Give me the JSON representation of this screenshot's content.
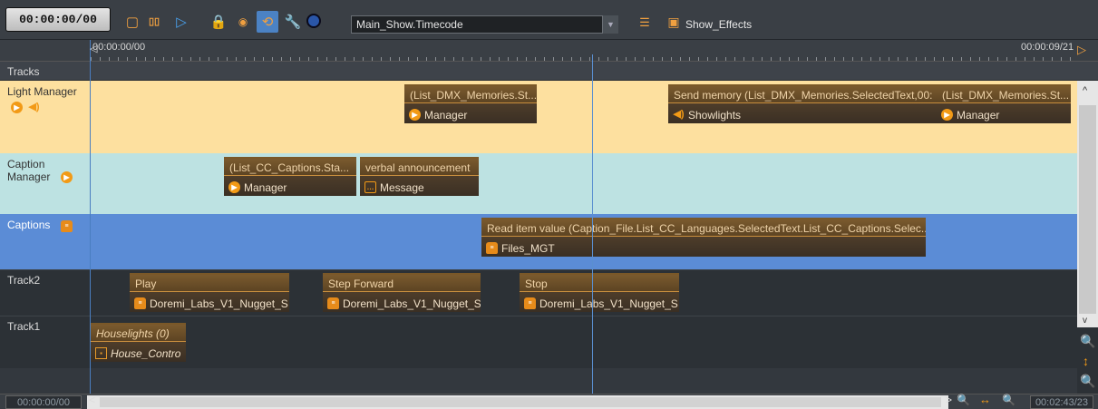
{
  "toolbar": {
    "timecode": "00:00:00/00",
    "show_select_value": "Main_Show.Timecode",
    "effects_label": "Show_Effects",
    "icons": [
      "stop-icon",
      "pause-icon",
      "play-icon",
      "lock-icon",
      "eye-icon",
      "history-icon",
      "wrench-icon",
      "record-icon",
      "list-icon",
      "window-icon"
    ]
  },
  "ruler": {
    "start": "00:00:00/00",
    "end": "00:00:09/21"
  },
  "tracks_label": "Tracks",
  "tracks": [
    {
      "name": "Light Manager",
      "color": "#fde09f",
      "clips": [
        {
          "title": "(List_DMX_Memories.St...",
          "sub": "Manager",
          "icon": "play-icon"
        },
        {
          "title": "Send memory (List_DMX_Memories.SelectedText,00:",
          "sub": "Showlights",
          "icon": "speaker-icon"
        },
        {
          "title": "(List_DMX_Memories.St...",
          "sub": "Manager",
          "icon": "play-icon"
        }
      ]
    },
    {
      "name": "Caption Manager",
      "color": "#bde2e2",
      "clips": [
        {
          "title": "(List_CC_Captions.Sta...",
          "sub": "Manager",
          "icon": "play-icon"
        },
        {
          "title": "verbal announcement",
          "sub": "Message",
          "icon": "message-icon"
        }
      ]
    },
    {
      "name": "Captions",
      "color": "#5b8cd6",
      "clips": [
        {
          "title": "Read item value (Caption_File.List_CC_Languages.SelectedText.List_CC_Captions.Selec...",
          "sub": "Files_MGT",
          "icon": "database-icon"
        }
      ]
    },
    {
      "name": "Track2",
      "color": "#2c3136",
      "clips": [
        {
          "title": "Play",
          "sub": "Doremi_Labs_V1_Nugget_S",
          "icon": "database-icon"
        },
        {
          "title": "Step Forward",
          "sub": "Doremi_Labs_V1_Nugget_S",
          "icon": "database-icon"
        },
        {
          "title": "Stop",
          "sub": "Doremi_Labs_V1_Nugget_S",
          "icon": "database-icon"
        }
      ]
    },
    {
      "name": "Track1",
      "color": "#2c3136",
      "clips": [
        {
          "title": "Houselights (0)",
          "sub": "House_Contro",
          "icon": "house-icon"
        }
      ]
    }
  ],
  "footer": {
    "position": "00:00:00/00",
    "duration": "00:02:43/23"
  }
}
